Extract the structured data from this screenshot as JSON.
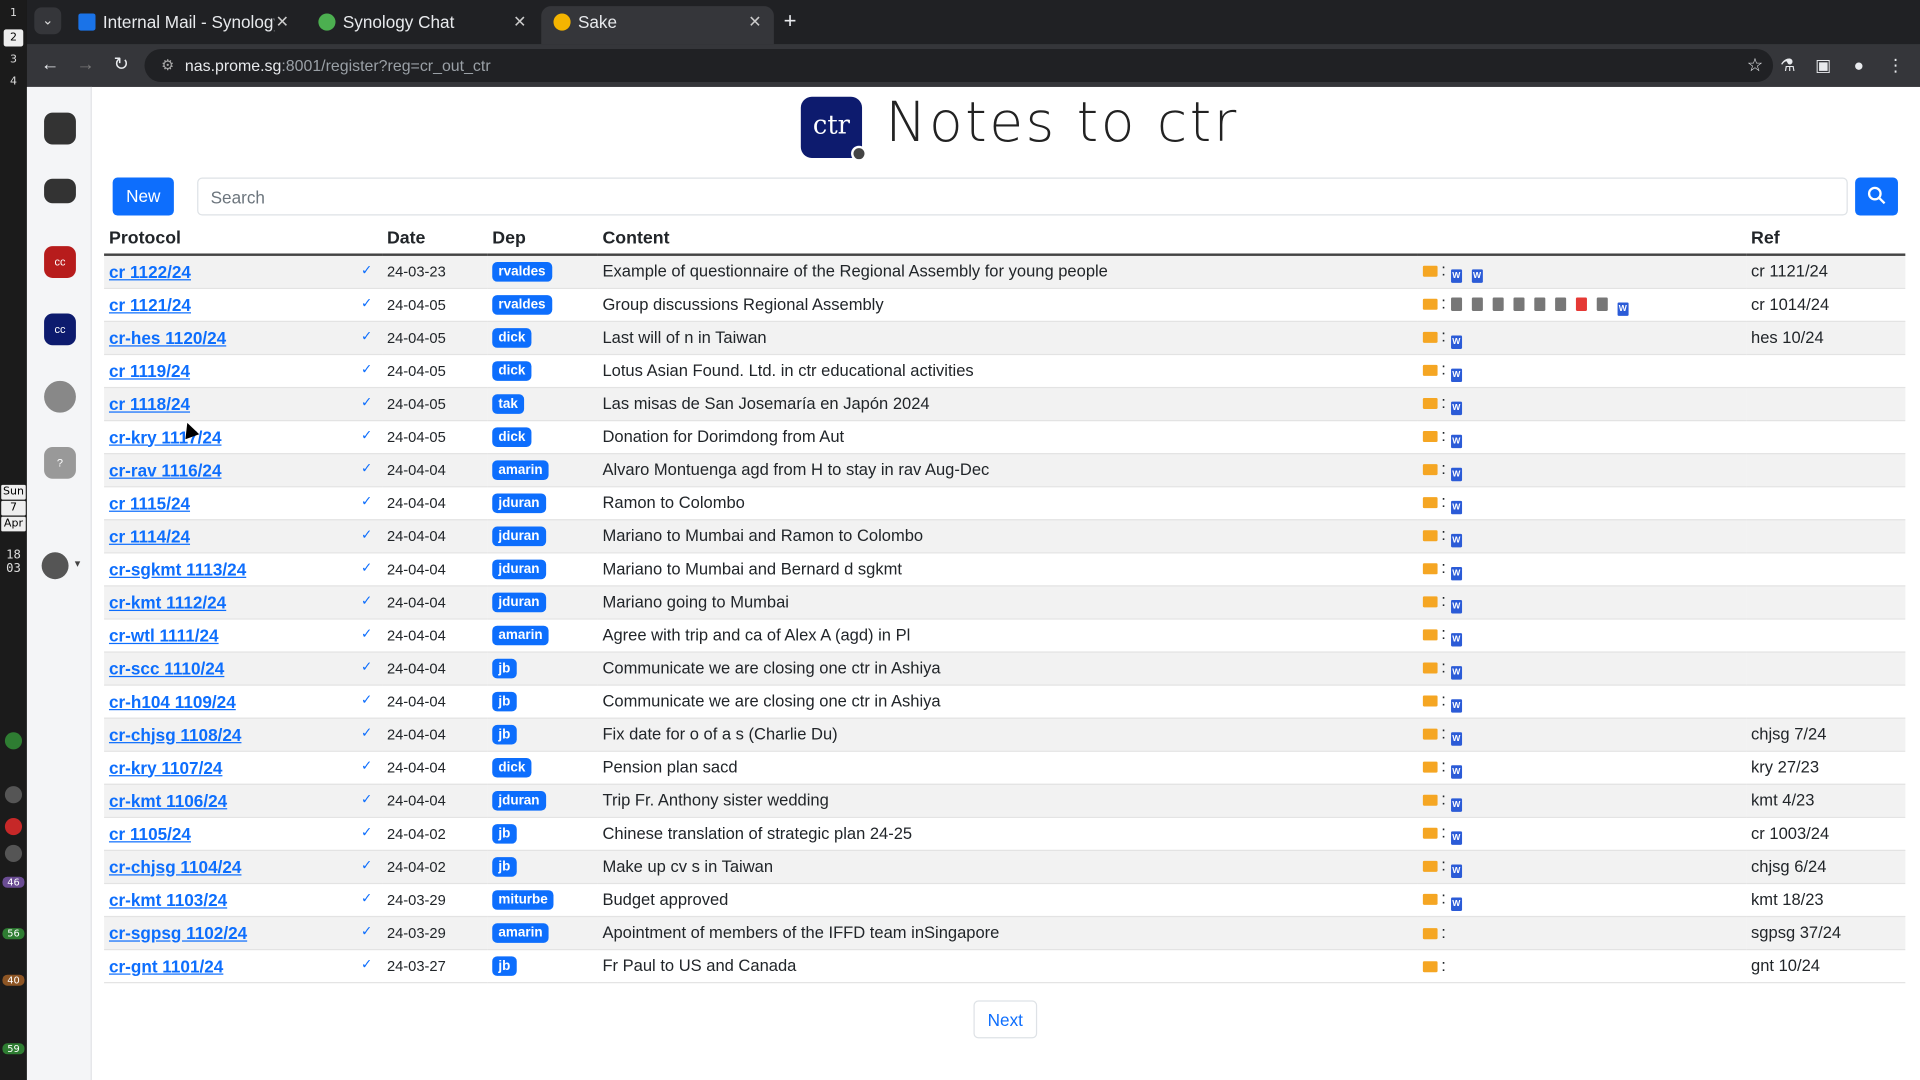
{
  "os": {
    "workspaces": [
      "1",
      "2",
      "3",
      "4"
    ],
    "date_day": "Sun",
    "date_num": "7",
    "date_month": "Apr",
    "clock_h": "18",
    "clock_m": "03",
    "indicators": [
      "46",
      "56",
      "40",
      "59"
    ]
  },
  "browser": {
    "tabs": [
      {
        "title": "Internal Mail - Synology",
        "fav_color": "#1a73e8"
      },
      {
        "title": "Synology Chat",
        "fav_color": "#4caf50"
      },
      {
        "title": "Sake",
        "fav_color": "#f4b400"
      }
    ],
    "active_tab": 2,
    "url_host": "nas.prome.sg",
    "url_rest": ":8001/register?reg=cr_out_ctr"
  },
  "rail": {
    "apps": [
      {
        "icon": "mail-stack-icon",
        "color": "#333"
      },
      {
        "icon": "inbox-tray-icon",
        "color": "#333"
      },
      {
        "icon": "cc-red-app-icon",
        "label": "cc",
        "color": "#b71c1c"
      },
      {
        "icon": "cc-blue-app-icon",
        "label": "cc",
        "color": "#0d1b6e"
      },
      {
        "icon": "link-swirl-icon",
        "color": "#888"
      },
      {
        "icon": "help-icon",
        "label": "?",
        "color": "#999"
      }
    ]
  },
  "header": {
    "logo_text": "ctr",
    "title": "Notes to ctr"
  },
  "toolbar": {
    "new_label": "New",
    "search_placeholder": "Search"
  },
  "table": {
    "columns": [
      "Protocol",
      "Date",
      "Dep",
      "Content",
      "",
      "Ref"
    ],
    "rows": [
      {
        "protocol": "cr 1122/24",
        "date": "24-03-23",
        "dep": "rvaldes",
        "content": "Example of questionnaire of the Regional Assembly for young people",
        "files": [
          "word",
          "word"
        ],
        "ref": "cr 1121/24"
      },
      {
        "protocol": "cr 1121/24",
        "date": "24-04-05",
        "dep": "rvaldes",
        "content": "Group discussions Regional Assembly",
        "files": [
          "generic",
          "generic",
          "generic",
          "generic",
          "generic",
          "generic",
          "pdf",
          "generic",
          "word"
        ],
        "ref": "cr 1014/24"
      },
      {
        "protocol": "cr-hes 1120/24",
        "date": "24-04-05",
        "dep": "dick",
        "content": "Last will of n in Taiwan",
        "files": [
          "word"
        ],
        "ref": "hes 10/24"
      },
      {
        "protocol": "cr 1119/24",
        "date": "24-04-05",
        "dep": "dick",
        "content": "Lotus Asian Found. Ltd. in ctr educational activities",
        "files": [
          "word"
        ],
        "ref": ""
      },
      {
        "protocol": "cr 1118/24",
        "date": "24-04-05",
        "dep": "tak",
        "content": "Las misas de San Josemaría en Japón 2024",
        "files": [
          "word"
        ],
        "ref": ""
      },
      {
        "protocol": "cr-kry 1117/24",
        "date": "24-04-05",
        "dep": "dick",
        "content": "Donation for Dorimdong from Aut",
        "files": [
          "word"
        ],
        "ref": ""
      },
      {
        "protocol": "cr-rav 1116/24",
        "date": "24-04-04",
        "dep": "amarin",
        "content": "Alvaro Montuenga agd from H to stay in rav Aug-Dec",
        "files": [
          "word"
        ],
        "ref": ""
      },
      {
        "protocol": "cr 1115/24",
        "date": "24-04-04",
        "dep": "jduran",
        "content": "Ramon to Colombo",
        "files": [
          "word"
        ],
        "ref": ""
      },
      {
        "protocol": "cr 1114/24",
        "date": "24-04-04",
        "dep": "jduran",
        "content": "Mariano to Mumbai and Ramon to Colombo",
        "files": [
          "word"
        ],
        "ref": ""
      },
      {
        "protocol": "cr-sgkmt 1113/24",
        "date": "24-04-04",
        "dep": "jduran",
        "content": "Mariano to Mumbai and Bernard d sgkmt",
        "files": [
          "word"
        ],
        "ref": ""
      },
      {
        "protocol": "cr-kmt 1112/24",
        "date": "24-04-04",
        "dep": "jduran",
        "content": "Mariano going to Mumbai",
        "files": [
          "word"
        ],
        "ref": ""
      },
      {
        "protocol": "cr-wtl 1111/24",
        "date": "24-04-04",
        "dep": "amarin",
        "content": "Agree with trip and ca of Alex A (agd) in Pl",
        "files": [
          "word"
        ],
        "ref": ""
      },
      {
        "protocol": "cr-scc 1110/24",
        "date": "24-04-04",
        "dep": "jb",
        "content": "Communicate we are closing one ctr in Ashiya",
        "files": [
          "word"
        ],
        "ref": ""
      },
      {
        "protocol": "cr-h104 1109/24",
        "date": "24-04-04",
        "dep": "jb",
        "content": "Communicate we are closing one ctr in Ashiya",
        "files": [
          "word"
        ],
        "ref": ""
      },
      {
        "protocol": "cr-chjsg 1108/24",
        "date": "24-04-04",
        "dep": "jb",
        "content": "Fix date for o of a s (Charlie Du)",
        "files": [
          "word"
        ],
        "ref": "chjsg 7/24"
      },
      {
        "protocol": "cr-kry 1107/24",
        "date": "24-04-04",
        "dep": "dick",
        "content": "Pension plan sacd",
        "files": [
          "word"
        ],
        "ref": "kry 27/23"
      },
      {
        "protocol": "cr-kmt 1106/24",
        "date": "24-04-04",
        "dep": "jduran",
        "content": "Trip Fr. Anthony sister wedding",
        "files": [
          "word"
        ],
        "ref": "kmt 4/23"
      },
      {
        "protocol": "cr 1105/24",
        "date": "24-04-02",
        "dep": "jb",
        "content": "Chinese translation of strategic plan 24-25",
        "files": [
          "word"
        ],
        "ref": "cr 1003/24"
      },
      {
        "protocol": "cr-chjsg 1104/24",
        "date": "24-04-02",
        "dep": "jb",
        "content": "Make up cv s in Taiwan",
        "files": [
          "word"
        ],
        "ref": "chjsg 6/24"
      },
      {
        "protocol": "cr-kmt 1103/24",
        "date": "24-03-29",
        "dep": "miturbe",
        "content": "Budget approved",
        "files": [
          "word"
        ],
        "ref": "kmt 18/23"
      },
      {
        "protocol": "cr-sgpsg 1102/24",
        "date": "24-03-29",
        "dep": "amarin",
        "content": "Apointment of members of the IFFD team inSingapore",
        "files": [],
        "ref": "sgpsg 37/24"
      },
      {
        "protocol": "cr-gnt 1101/24",
        "date": "24-03-27",
        "dep": "jb",
        "content": "Fr Paul to US and Canada",
        "files": [],
        "ref": "gnt 10/24"
      }
    ]
  },
  "pager": {
    "next_label": "Next"
  },
  "colors": {
    "accent": "#0d6efd",
    "logo_bg": "#0d1b6e",
    "folder": "#f5a623"
  }
}
